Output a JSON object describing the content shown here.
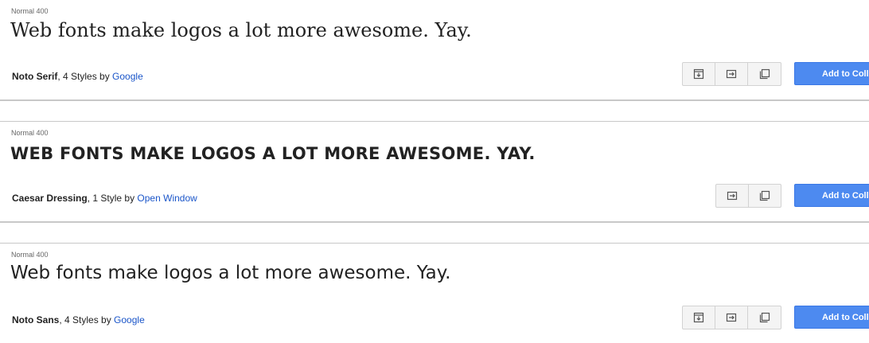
{
  "fonts": [
    {
      "style_label": "Normal 400",
      "sample_text": "Web fonts make logos a lot more awesome. Yay.",
      "font_name": "Noto Serif",
      "styles_text": ", 4 Styles by ",
      "author": "Google",
      "add_label": "Add to Collection"
    },
    {
      "style_label": "Normal 400",
      "sample_text": "WEB FONTS MAKE LOGOS A LOT MORE AWESOME. YAY.",
      "font_name": "Caesar Dressing",
      "styles_text": ", 1 Style by ",
      "author": "Open Window",
      "add_label": "Add to Collection"
    },
    {
      "style_label": "Normal 400",
      "sample_text": "Web fonts make logos a lot more awesome. Yay.",
      "font_name": "Noto Sans",
      "styles_text": ", 4 Styles by ",
      "author": "Google",
      "add_label": "Add to Collection"
    }
  ],
  "icons": {
    "styles": "styles-icon",
    "quick_use": "quick-use-icon",
    "pop_out": "pop-out-icon"
  },
  "colors": {
    "accent": "#4d8af0",
    "link": "#1a55c9"
  }
}
